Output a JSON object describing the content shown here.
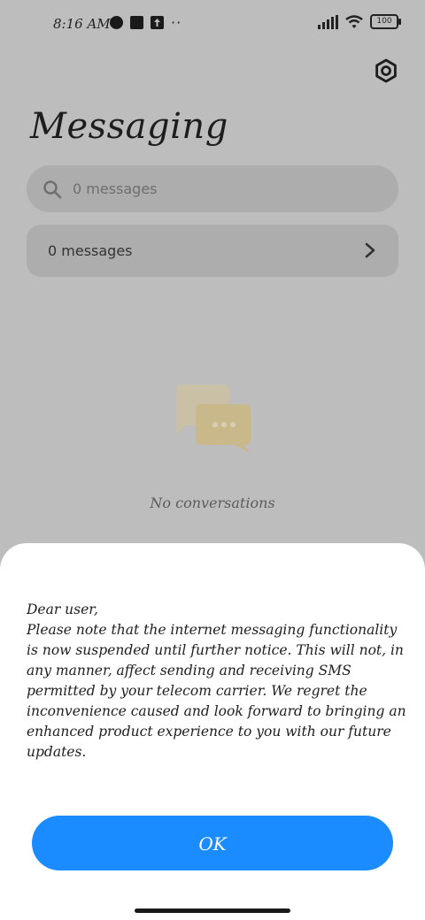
{
  "status_bar": {
    "time": "8:16 AM",
    "battery": "100",
    "more": "··",
    "icons": [
      "notification-circle-icon",
      "square-icon",
      "upload-icon",
      "signal-icon",
      "wifi-icon",
      "battery-icon"
    ]
  },
  "header": {
    "title": "Messaging",
    "settings_icon": "gear-icon"
  },
  "search": {
    "placeholder": "0 messages"
  },
  "summary": {
    "label": "0 messages"
  },
  "empty_state": {
    "icon": "chat-bubbles-icon",
    "text": "No conversations"
  },
  "dialog": {
    "greeting": "Dear user,",
    "body": "Please note that the internet messaging functionality is now suspended until further notice. This will not, in any manner, affect sending and receiving SMS permitted by your telecom carrier. We regret the inconvenience caused and look forward to bringing an enhanced product experience to you with our future updates.",
    "ok_label": "OK"
  },
  "colors": {
    "accent": "#1a8cff",
    "scrim": "#bdbdbd",
    "sheet": "#ffffff"
  }
}
